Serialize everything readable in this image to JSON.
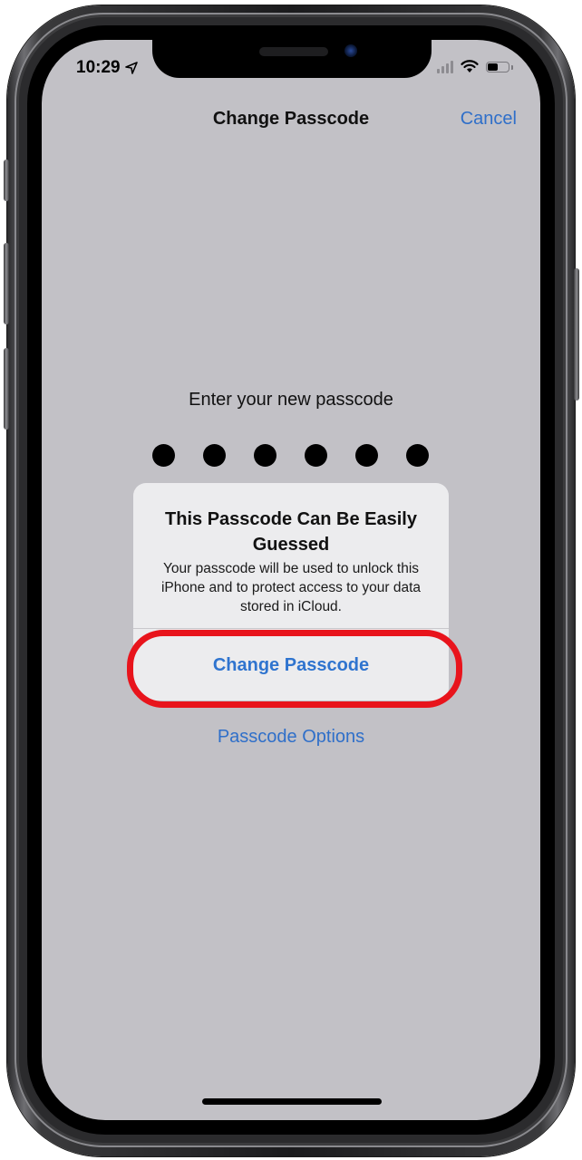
{
  "status_bar": {
    "time": "10:29",
    "location_icon": "location-arrow-icon",
    "signal_icon": "cellular-signal-icon",
    "wifi_icon": "wifi-icon",
    "battery_icon": "battery-icon",
    "battery_level": 0.5
  },
  "nav": {
    "title": "Change Passcode",
    "cancel_label": "Cancel"
  },
  "passcode": {
    "prompt": "Enter your new passcode",
    "digits_entered": 6,
    "digits_total": 6
  },
  "alert": {
    "title": "This Passcode Can Be Easily Guessed",
    "message": "Your passcode will be used to unlock this iPhone and to protect access to your data stored in iCloud.",
    "button_label": "Change Passcode"
  },
  "options_label": "Passcode Options",
  "colors": {
    "accent": "#2f6fc9",
    "highlight": "#e8141c",
    "screen_bg": "#c2c1c6",
    "alert_bg": "#ececee"
  }
}
